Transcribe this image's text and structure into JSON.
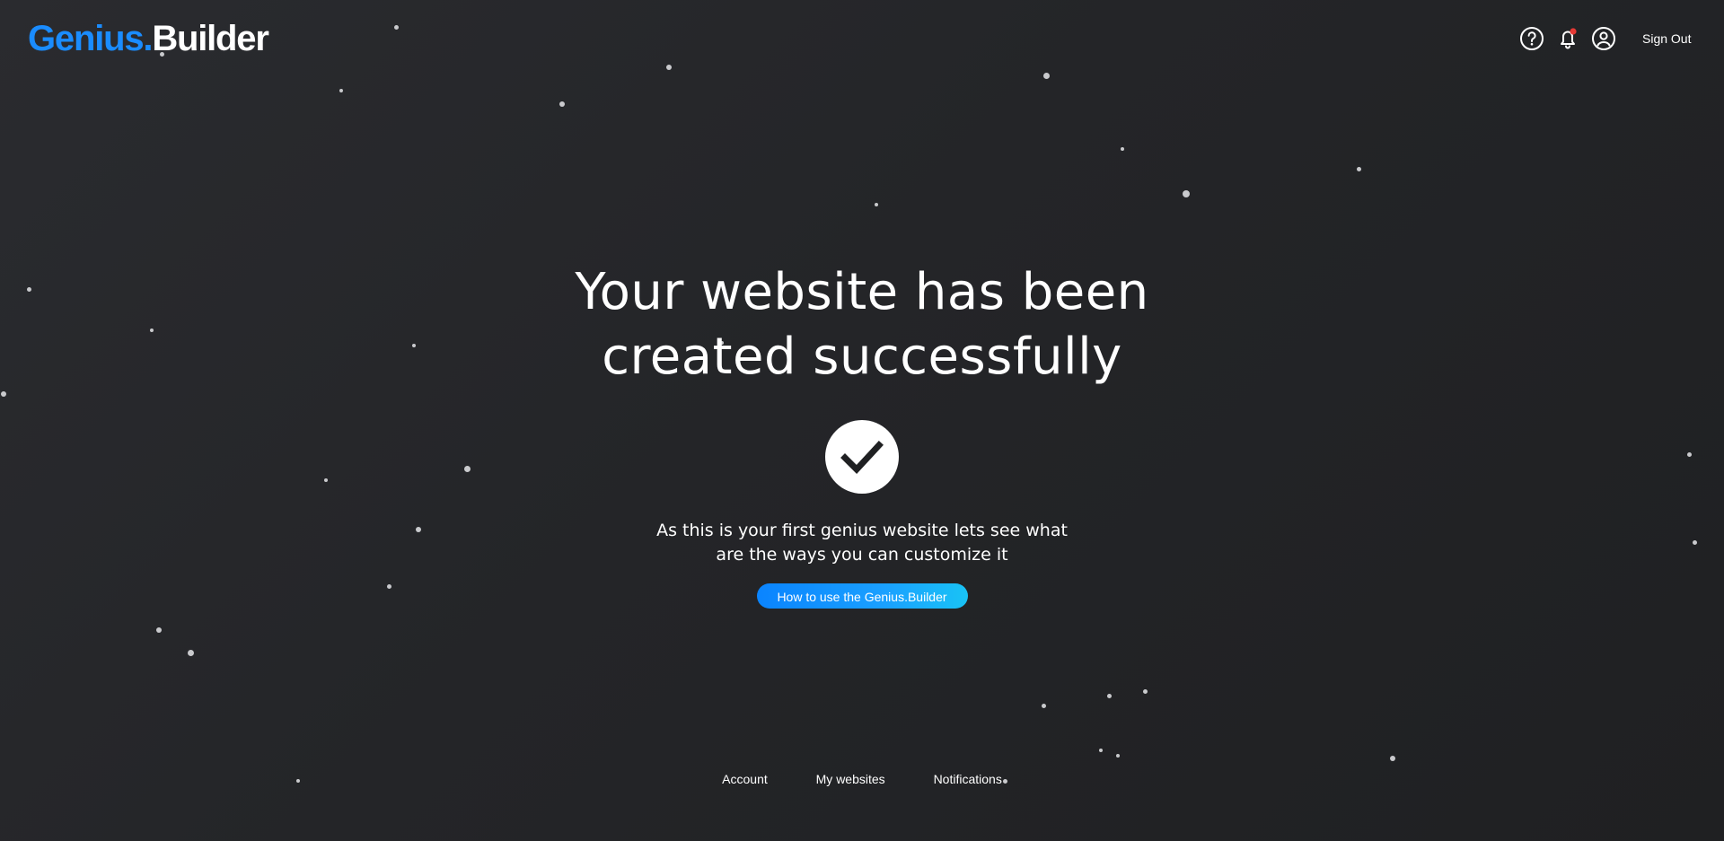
{
  "header": {
    "logo_primary": "Genius.",
    "logo_secondary": "Builder",
    "signout_label": "Sign Out",
    "notification_badge_color": "#e53935"
  },
  "main": {
    "headline": "Your website has been created successfully",
    "subtext": "As this is your first genius website lets see what are the ways you can customize it",
    "cta_label": "How to use the Genius.Builder"
  },
  "footer": {
    "links": [
      "Account",
      "My websites",
      "Notifications"
    ]
  },
  "colors": {
    "background": "#242528",
    "brand_blue": "#1a8cff",
    "cta_gradient_start": "#0a84ff",
    "cta_gradient_end": "#19c3f5"
  }
}
